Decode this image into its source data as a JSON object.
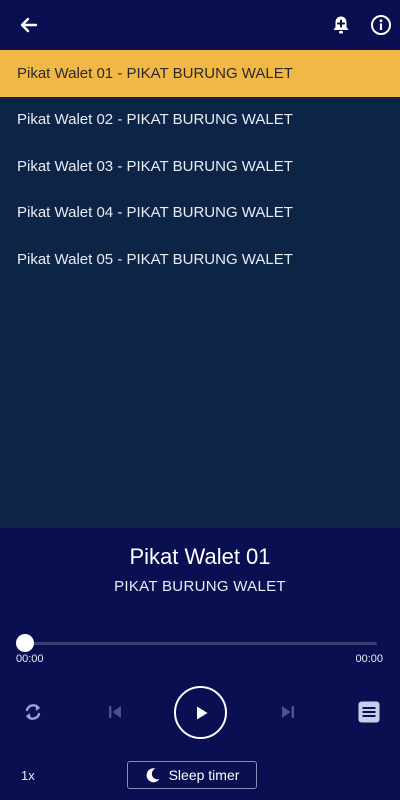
{
  "appbar": {
    "back_icon": "arrow-left-icon",
    "alarm_icon": "bell-plus-icon",
    "info_icon": "info-icon"
  },
  "playlist": {
    "active_index": 0,
    "items": [
      {
        "label": "Pikat Walet 01 - PIKAT BURUNG WALET"
      },
      {
        "label": "Pikat Walet 02 - PIKAT BURUNG WALET"
      },
      {
        "label": "Pikat Walet 03 - PIKAT BURUNG WALET"
      },
      {
        "label": "Pikat Walet 04 - PIKAT BURUNG WALET"
      },
      {
        "label": "Pikat Walet 05 - PIKAT BURUNG WALET"
      }
    ]
  },
  "player": {
    "title": "Pikat Walet 01",
    "artist": "PIKAT BURUNG WALET",
    "current_time": "00:00",
    "duration": "00:00",
    "progress": 0,
    "speed": "1x",
    "sleep_timer_label": "Sleep timer"
  },
  "colors": {
    "background": "#0a0f52",
    "list_background": "#0c2547",
    "active_row": "#f2b846"
  }
}
